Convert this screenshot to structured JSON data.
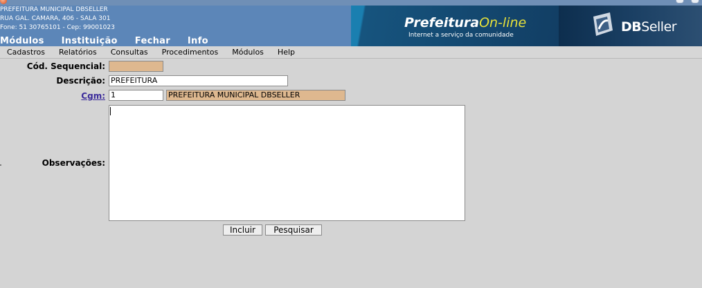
{
  "header": {
    "address_lines": [
      "PREFEITURA MUNICIPAL DBSELLER",
      "RUA GAL. CAMARA, 406 - SALA 301",
      "Fone: 51 30765101  -  Cep: 99001023"
    ],
    "top_menu": [
      "Módulos",
      "Instituição",
      "Fechar",
      "Info"
    ],
    "logo_main": "Prefeitura",
    "logo_online": "On-line",
    "logo_tagline": "Internet a serviço da comunidade",
    "brand_db": "DB",
    "brand_seller": "Seller"
  },
  "menubar": [
    "Cadastros",
    "Relatórios",
    "Consultas",
    "Procedimentos",
    "Módulos",
    "Help"
  ],
  "form": {
    "cod_label": "Cód. Sequencial:",
    "cod_value": "",
    "descricao_label": "Descrição:",
    "descricao_value": "PREFEITURA",
    "cgm_label": "Cgm:",
    "cgm_value": "1",
    "cgm_name": "PREFEITURA MUNICIPAL DBSELLER",
    "observacoes_label": "Observações:",
    "observacoes_value": ""
  },
  "buttons": {
    "incluir": "Incluir",
    "pesquisar": "Pesquisar"
  },
  "colors": {
    "header_bg": "#5c86b8",
    "readonly_field": "#deb88f",
    "page_bg": "#d4d4d4",
    "link": "#3a2a9a"
  }
}
